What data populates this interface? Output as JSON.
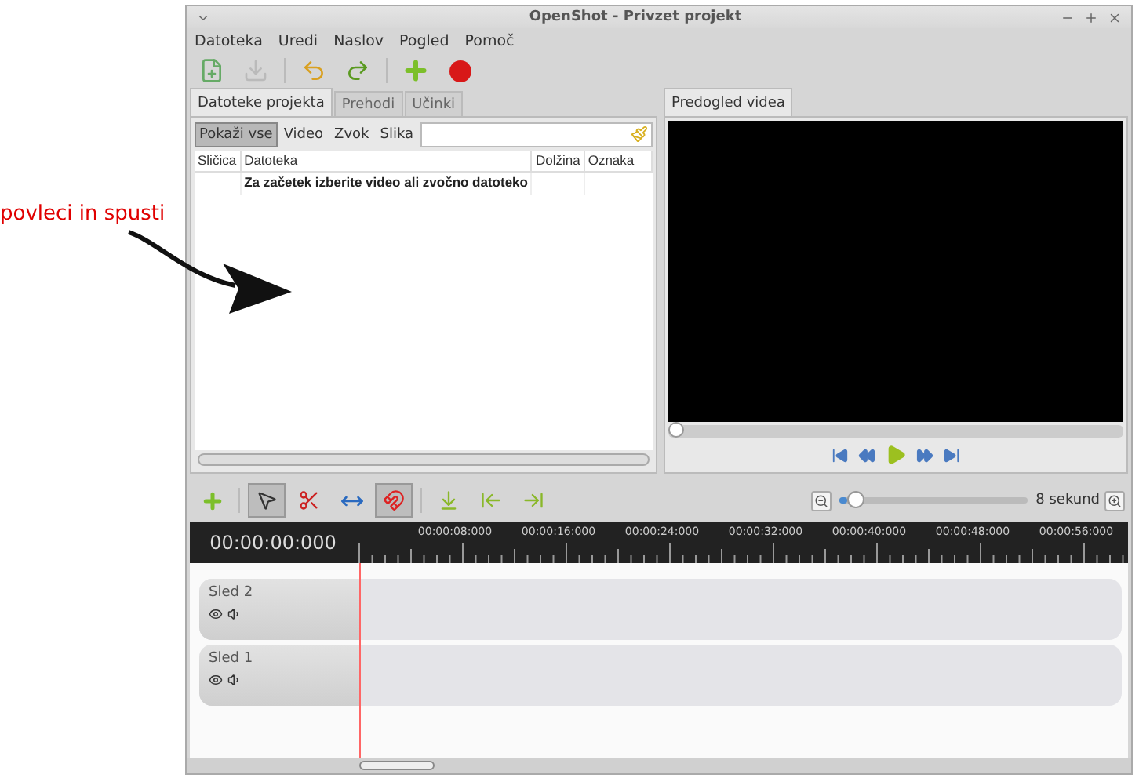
{
  "annotation": {
    "text": "povleci in spusti"
  },
  "window": {
    "title": "OpenShot - Privzet projekt"
  },
  "menu": [
    "Datoteka",
    "Uredi",
    "Naslov",
    "Pogled",
    "Pomoč"
  ],
  "toolbar": [
    {
      "kind": "new",
      "disabled": false
    },
    {
      "kind": "save",
      "disabled": true
    },
    {
      "kind": "undo",
      "disabled": false
    },
    {
      "kind": "redo",
      "disabled": false
    },
    {
      "kind": "add",
      "disabled": false
    },
    {
      "kind": "record",
      "disabled": false
    }
  ],
  "project_tabs": [
    {
      "label": "Datoteke projekta",
      "selected": true
    },
    {
      "label": "Prehodi",
      "selected": false
    },
    {
      "label": "Učinki",
      "selected": false
    }
  ],
  "filters": [
    {
      "label": "Pokaži vse",
      "selected": true
    },
    {
      "label": "Video",
      "selected": false
    },
    {
      "label": "Zvok",
      "selected": false
    },
    {
      "label": "Slika",
      "selected": false
    }
  ],
  "table": {
    "columns": [
      "Sličica",
      "Datoteka",
      "Dolžina",
      "Oznaka"
    ],
    "hint": "Za začetek izberite video ali zvočno datoteko"
  },
  "preview": {
    "tab": {
      "label": "Predogled videa",
      "selected": true
    },
    "level": 0
  },
  "timeline_tools": [
    {
      "kind": "add",
      "selected": false
    },
    {
      "kind": "pointer",
      "selected": true
    },
    {
      "kind": "razor",
      "selected": false
    },
    {
      "kind": "resize",
      "selected": false
    },
    {
      "kind": "snap",
      "selected": true
    },
    {
      "kind": "marker",
      "selected": false
    },
    {
      "kind": "previous",
      "selected": false
    },
    {
      "kind": "next",
      "selected": false
    }
  ],
  "zoom": {
    "level": 0.04,
    "reading": "8 sekund"
  },
  "ruler": {
    "timecode": "00:00:00:000",
    "labels": [
      "00:00:08:000",
      "00:00:16:000",
      "00:00:24:000",
      "00:00:32:000",
      "00:00:40:000",
      "00:00:48:000",
      "00:00:56:000"
    ]
  },
  "tracks": [
    {
      "name": "Sled 2"
    },
    {
      "name": "Sled 1"
    }
  ]
}
